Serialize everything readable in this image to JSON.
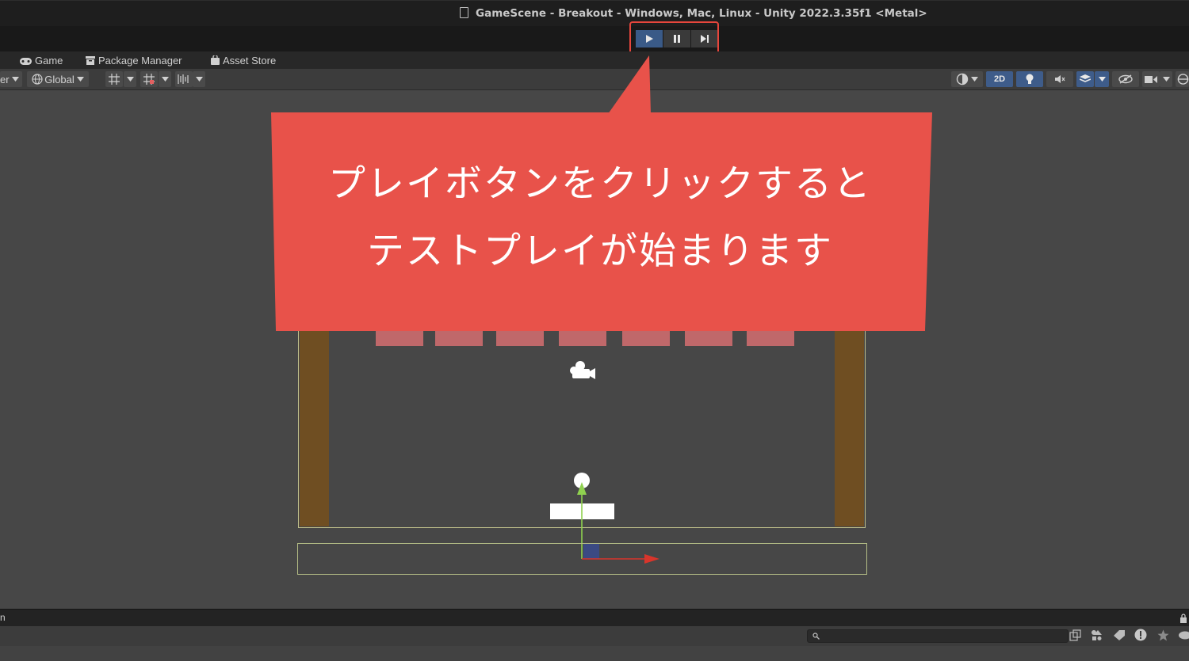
{
  "window": {
    "title": "GameScene - Breakout - Windows, Mac, Linux - Unity 2022.3.35f1 <Metal>"
  },
  "play_controls": {
    "play": "play-icon",
    "pause": "pause-icon",
    "step": "step-icon"
  },
  "tabs": [
    {
      "label": "Game",
      "icon": "gamepad-icon"
    },
    {
      "label": "Package Manager",
      "icon": "package-icon"
    },
    {
      "label": "Asset Store",
      "icon": "bag-icon"
    }
  ],
  "scene_toolbar": {
    "pivot_fragment": "er",
    "global_label": "Global",
    "mode_2d": "2D"
  },
  "callout": {
    "line1": "プレイボタンをクリックすると",
    "line2": "テストプレイが始まります",
    "color": "#e8524a"
  },
  "colors": {
    "accent": "#3e5c8a",
    "highlight": "#e6463c",
    "wall": "#6f4e22",
    "brick": "#c0686a"
  }
}
